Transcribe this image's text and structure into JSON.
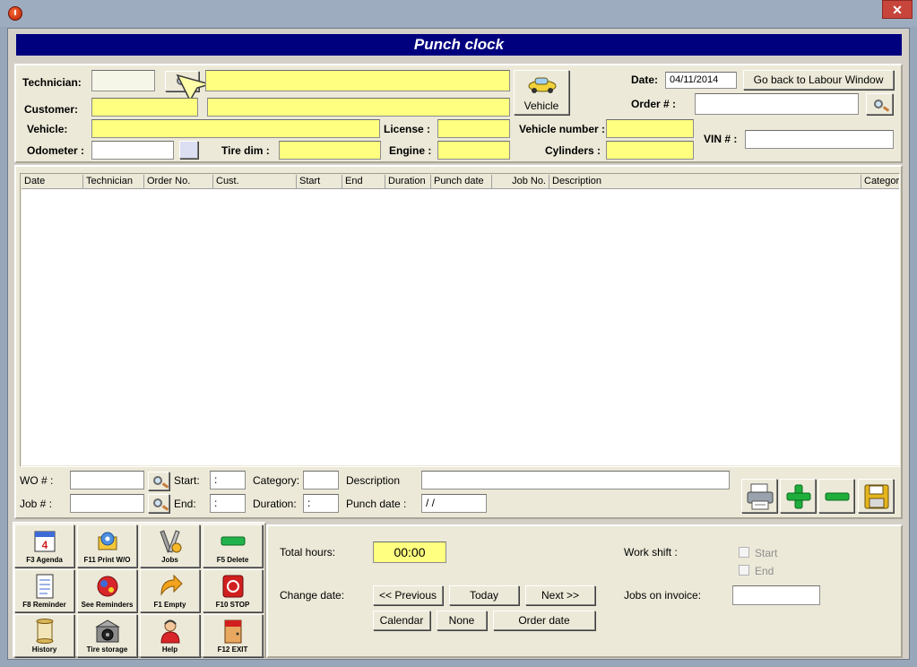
{
  "window": {
    "close_glyph": "✕"
  },
  "banner_title": "Punch clock",
  "header": {
    "technician_label": "Technician:",
    "technician_code": "",
    "technician_name": "",
    "customer_label": "Customer:",
    "customer_code": "",
    "customer_name": "",
    "vehicle_label": "Vehicle:",
    "vehicle_value": "",
    "odometer_label": "Odometer :",
    "odometer_value": "",
    "tire_dim_label": "Tire dim :",
    "tire_dim_value": "",
    "license_label": "License :",
    "license_value": "",
    "engine_label": "Engine :",
    "engine_value": "",
    "vehicle_button": "Vehicle",
    "vehicle_number_label": "Vehicle number :",
    "vehicle_number_value": "",
    "cylinders_label": "Cylinders :",
    "cylinders_value": "",
    "date_label": "Date:",
    "date_value": "04/11/2014",
    "go_back_button": "Go back to Labour Window",
    "order_label": "Order # :",
    "order_value": "",
    "vin_label": "VIN # :",
    "vin_value": ""
  },
  "grid": {
    "columns": [
      "Date",
      "Technician",
      "Order No.",
      "Cust.",
      "Start",
      "End",
      "Duration",
      "Punch date",
      "Job No.",
      "Description",
      "Categor"
    ],
    "rows": []
  },
  "detail": {
    "wo_label": "WO # :",
    "wo_value": "",
    "job_label": "Job # :",
    "job_value": "",
    "start_label": "Start:",
    "start_value": ":",
    "end_label": "End:",
    "end_value": ":",
    "category_label": "Category:",
    "category_value": "",
    "duration_label": "Duration:",
    "duration_value": ":",
    "description_label": "Description",
    "description_value": "",
    "punch_date_label": "Punch date :",
    "punch_date_value": "/ /"
  },
  "shortcuts": [
    {
      "label": "F3 Agenda",
      "icon": "calendar-icon"
    },
    {
      "label": "F11 Print W/O",
      "icon": "print-gear-icon"
    },
    {
      "label": "Jobs",
      "icon": "tools-icon"
    },
    {
      "label": "F5 Delete",
      "icon": "delete-bar-icon"
    },
    {
      "label": "F8 Reminder",
      "icon": "reminder-icon"
    },
    {
      "label": "See Reminders",
      "icon": "reminders-icon"
    },
    {
      "label": "F1 Empty",
      "icon": "empty-arrow-icon"
    },
    {
      "label": "F10 STOP",
      "icon": "stop-icon"
    },
    {
      "label": "History",
      "icon": "history-scroll-icon"
    },
    {
      "label": "Tire storage",
      "icon": "tire-storage-icon"
    },
    {
      "label": "Help",
      "icon": "help-person-icon"
    },
    {
      "label": "F12 EXIT",
      "icon": "exit-door-icon"
    }
  ],
  "summary": {
    "total_hours_label": "Total hours:",
    "total_hours_value": "00:00",
    "change_date_label": "Change date:",
    "previous_button": "<< Previous",
    "today_button": "Today",
    "next_button": "Next >>",
    "calendar_button": "Calendar",
    "none_button": "None",
    "order_date_button": "Order date",
    "work_shift_label": "Work shift :",
    "start_check_label": "Start",
    "end_check_label": "End",
    "jobs_on_invoice_label": "Jobs on invoice:",
    "jobs_on_invoice_value": ""
  },
  "colors": {
    "banner_bg": "#00007e",
    "field_yellow": "#ffff80",
    "panel_bg": "#ece9d8",
    "delete_green": "#22b24c",
    "add_green": "#1fae3b",
    "stop_red": "#d11f1f"
  }
}
